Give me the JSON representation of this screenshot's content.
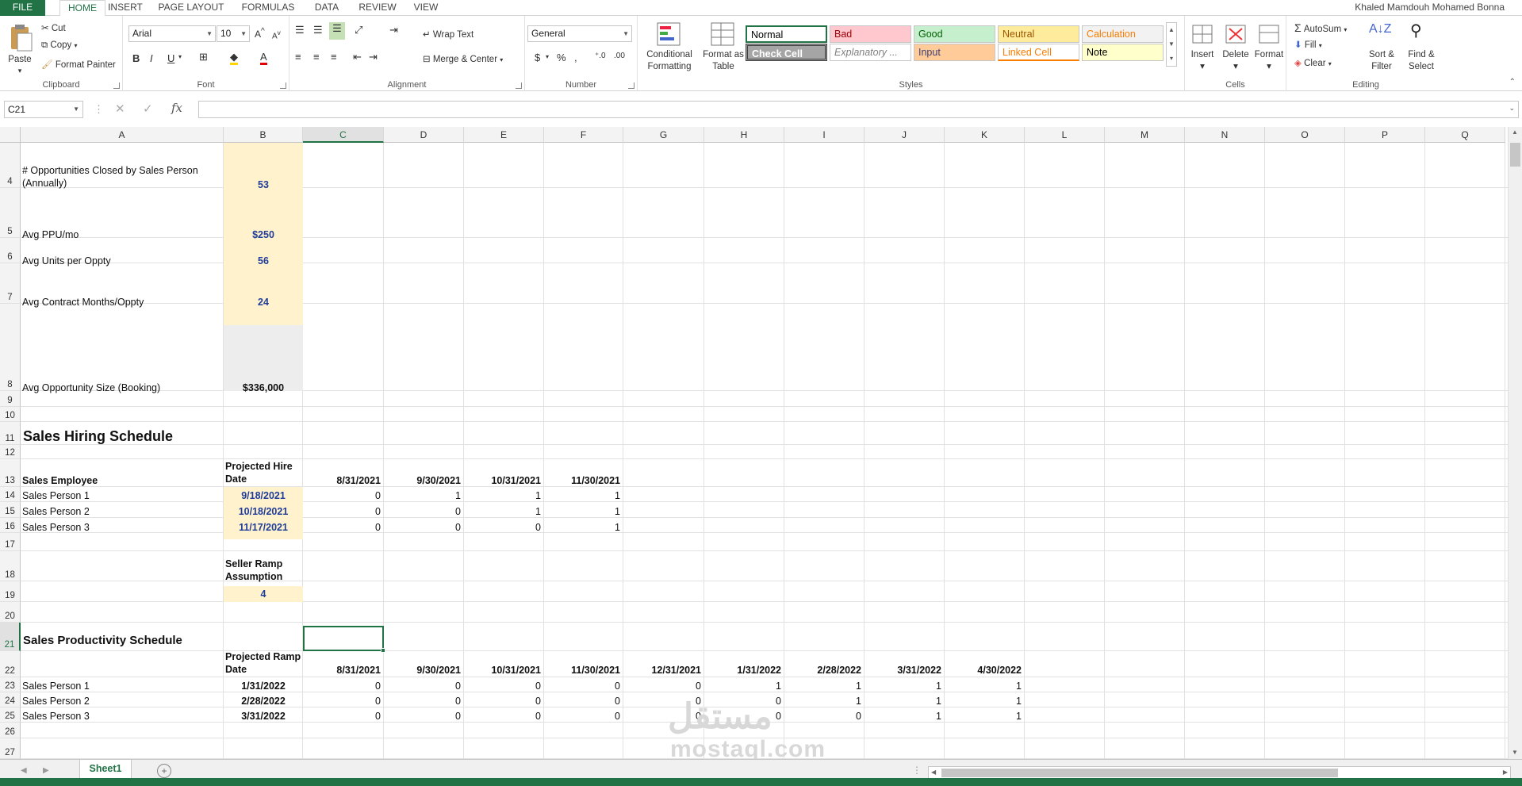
{
  "ribbon_tabs": [
    "FILE",
    "HOME",
    "INSERT",
    "PAGE LAYOUT",
    "FORMULAS",
    "DATA",
    "REVIEW",
    "VIEW"
  ],
  "user_name": "Khaled  Mamdouh Mohamed Bonna",
  "clipboard": {
    "paste": "Paste",
    "cut": "Cut",
    "copy": "Copy",
    "format_painter": "Format Painter",
    "label": "Clipboard"
  },
  "font": {
    "name": "Arial",
    "size": "10",
    "label": "Font"
  },
  "alignment": {
    "wrap": "Wrap Text",
    "merge": "Merge & Center",
    "label": "Alignment"
  },
  "number": {
    "format": "General",
    "label": "Number"
  },
  "styles": {
    "conditional": "Conditional Formatting",
    "format_table": "Format as Table",
    "cells": [
      {
        "label": "Normal",
        "bg": "#ffffff",
        "color": "#000000"
      },
      {
        "label": "Bad",
        "bg": "#ffc7ce",
        "color": "#9c0006"
      },
      {
        "label": "Good",
        "bg": "#c6efce",
        "color": "#006100"
      },
      {
        "label": "Neutral",
        "bg": "#ffeb9c",
        "color": "#9c5700"
      },
      {
        "label": "Calculation",
        "bg": "#f2f2f2",
        "color": "#fa7d00"
      },
      {
        "label": "Check Cell",
        "bg": "#a5a5a5",
        "color": "#ffffff"
      },
      {
        "label": "Explanatory ...",
        "bg": "#ffffff",
        "color": "#7f7f7f"
      },
      {
        "label": "Input",
        "bg": "#ffcc99",
        "color": "#3f3f76"
      },
      {
        "label": "Linked Cell",
        "bg": "#ffffff",
        "color": "#fa7d00"
      },
      {
        "label": "Note",
        "bg": "#ffffcc",
        "color": "#000000"
      }
    ],
    "label": "Styles"
  },
  "cells_group": {
    "insert": "Insert",
    "delete": "Delete",
    "format": "Format",
    "label": "Cells"
  },
  "editing": {
    "autosum": "AutoSum",
    "fill": "Fill",
    "clear": "Clear",
    "sort": "Sort & Filter",
    "find": "Find & Select",
    "label": "Editing"
  },
  "name_box": "C21",
  "formula": "",
  "columns": [
    "A",
    "B",
    "C",
    "D",
    "E",
    "F",
    "G",
    "H",
    "I",
    "J",
    "K",
    "L",
    "M",
    "N",
    "O",
    "P",
    "Q"
  ],
  "rows": [
    "4",
    "5",
    "6",
    "7",
    "8",
    "9",
    "10",
    "11",
    "12",
    "13",
    "14",
    "15",
    "16",
    "17",
    "18",
    "19",
    "20",
    "21",
    "22",
    "23",
    "24",
    "25",
    "26",
    "27"
  ],
  "sheet": {
    "r4a": "# Opportunities Closed by Sales Person (Annually)",
    "r4b": "53",
    "r5a": "Avg PPU/mo",
    "r5b": "$250",
    "r6a": "Avg Units per Oppty",
    "r6b": "56",
    "r7a": "Avg Contract Months/Oppty",
    "r7b": "24",
    "r8a": "Avg Opportunity Size (Booking)",
    "r8b": "$336,000",
    "r11a": "Sales Hiring Schedule",
    "r13a": "Sales Employee",
    "r13b": "Projected Hire Date",
    "hire_dates": [
      "8/31/2021",
      "9/30/2021",
      "10/31/2021",
      "11/30/2021"
    ],
    "hire_rows": [
      {
        "name": "Sales Person 1",
        "date": "9/18/2021",
        "vals": [
          "0",
          "1",
          "1",
          "1"
        ]
      },
      {
        "name": "Sales Person 2",
        "date": "10/18/2021",
        "vals": [
          "0",
          "0",
          "1",
          "1"
        ]
      },
      {
        "name": "Sales Person 3",
        "date": "11/17/2021",
        "vals": [
          "0",
          "0",
          "0",
          "1"
        ]
      }
    ],
    "r18b": "Seller Ramp Assumption",
    "r19b": "4",
    "r21a": "Sales Productivity Schedule",
    "r22b": "Projected Ramp Date",
    "prod_dates": [
      "8/31/2021",
      "9/30/2021",
      "10/31/2021",
      "11/30/2021",
      "12/31/2021",
      "1/31/2022",
      "2/28/2022",
      "3/31/2022",
      "4/30/2022"
    ],
    "prod_rows": [
      {
        "name": "Sales Person 1",
        "date": "1/31/2022",
        "vals": [
          "0",
          "0",
          "0",
          "0",
          "0",
          "1",
          "1",
          "1",
          "1"
        ]
      },
      {
        "name": "Sales Person 2",
        "date": "2/28/2022",
        "vals": [
          "0",
          "0",
          "0",
          "0",
          "0",
          "0",
          "1",
          "1",
          "1"
        ]
      },
      {
        "name": "Sales Person 3",
        "date": "3/31/2022",
        "vals": [
          "0",
          "0",
          "0",
          "0",
          "0",
          "0",
          "0",
          "1",
          "1"
        ]
      }
    ]
  },
  "sheet_tab": "Sheet1",
  "watermark": "مستقل",
  "watermark2": "mostaql.com"
}
